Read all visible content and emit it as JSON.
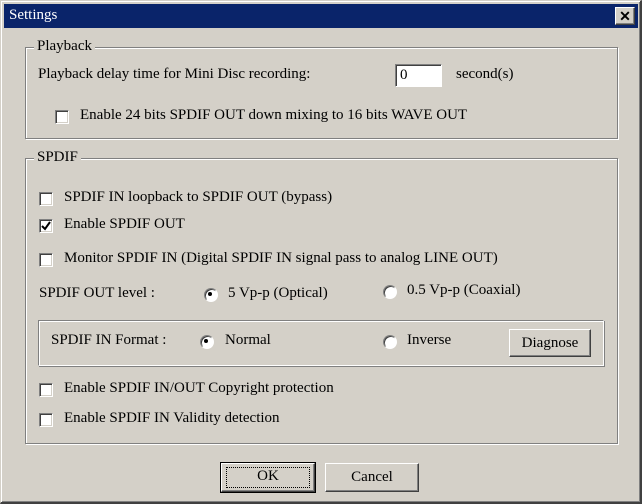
{
  "window": {
    "title": "Settings",
    "close_glyph": "✕"
  },
  "playback": {
    "group_label": "Playback",
    "delay_label": "Playback delay time for Mini Disc recording:",
    "delay_value": "0",
    "delay_unit": "second(s)",
    "downmix_label": "Enable 24 bits SPDIF OUT down mixing to 16 bits WAVE OUT",
    "downmix_checked": false
  },
  "spdif": {
    "group_label": "SPDIF",
    "loopback_label": "SPDIF IN loopback to SPDIF OUT (bypass)",
    "loopback_checked": false,
    "enable_out_label": "Enable SPDIF OUT",
    "enable_out_checked": true,
    "monitor_label": "Monitor SPDIF IN  (Digital SPDIF IN signal pass to analog LINE OUT)",
    "monitor_checked": false,
    "out_level_label": "SPDIF OUT level :",
    "out_level_options": [
      "5 Vp-p (Optical)",
      "0.5 Vp-p (Coaxial)"
    ],
    "out_level_selected": "5 Vp-p (Optical)",
    "in_format_label": "SPDIF IN Format :",
    "in_format_options": [
      "Normal",
      "Inverse"
    ],
    "in_format_selected": "Normal",
    "diagnose_label": "Diagnose",
    "copyright_label": "Enable SPDIF IN/OUT Copyright protection",
    "copyright_checked": false,
    "validity_label": "Enable SPDIF IN Validity detection",
    "validity_checked": false
  },
  "footer": {
    "ok_label": "OK",
    "cancel_label": "Cancel"
  },
  "icons": {
    "checkmark": "check-icon",
    "close": "close-icon"
  }
}
